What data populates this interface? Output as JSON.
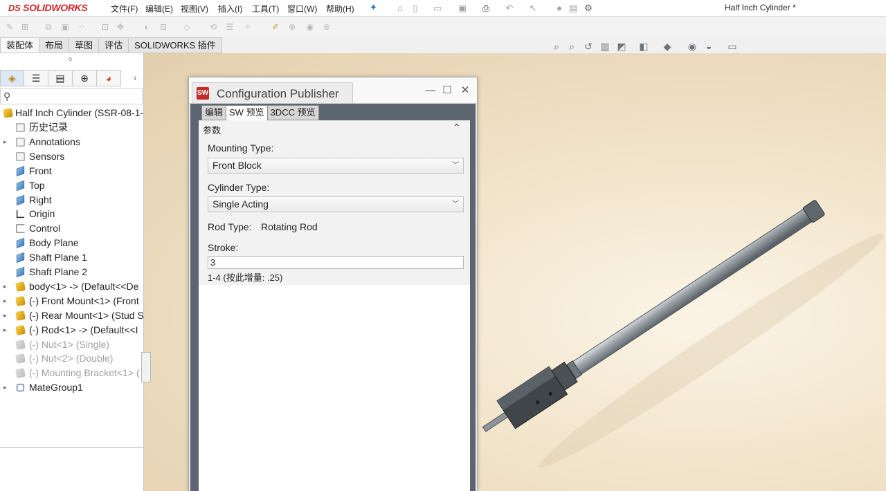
{
  "app": {
    "logo_prefix": "DS",
    "logo": "SOLIDWORKS",
    "document_title": "Half Inch Cylinder *"
  },
  "menu": [
    "文件(F)",
    "编辑(E)",
    "视图(V)",
    "插入(I)",
    "工具(T)",
    "窗口(W)",
    "帮助(H)"
  ],
  "command_tabs": [
    "装配体",
    "布局",
    "草图",
    "评估",
    "SOLIDWORKS 插件"
  ],
  "feature_tree": {
    "root": "Half Inch Cylinder  (SSR-08-1-",
    "items": [
      {
        "label": "历史记录",
        "icon": "history-icon",
        "expand": false,
        "dim": false
      },
      {
        "label": "Annotations",
        "icon": "annotations-icon",
        "expand": true,
        "dim": false
      },
      {
        "label": "Sensors",
        "icon": "sensors-icon",
        "expand": false,
        "dim": false
      },
      {
        "label": "Front",
        "icon": "plane-icon",
        "expand": false,
        "dim": false
      },
      {
        "label": "Top",
        "icon": "plane-icon",
        "expand": false,
        "dim": false
      },
      {
        "label": "Right",
        "icon": "plane-icon",
        "expand": false,
        "dim": false
      },
      {
        "label": "Origin",
        "icon": "origin-icon",
        "expand": false,
        "dim": false
      },
      {
        "label": "Control",
        "icon": "sketch-icon",
        "expand": false,
        "dim": false
      },
      {
        "label": "Body Plane",
        "icon": "plane-icon",
        "expand": false,
        "dim": false
      },
      {
        "label": "Shaft Plane 1",
        "icon": "plane-icon",
        "expand": false,
        "dim": false
      },
      {
        "label": "Shaft Plane 2",
        "icon": "plane-icon",
        "expand": false,
        "dim": false
      },
      {
        "label": "body<1> -> (Default<<De",
        "icon": "component-icon",
        "expand": true,
        "dim": false
      },
      {
        "label": "(-) Front Mount<1> (Front",
        "icon": "component-icon",
        "expand": true,
        "dim": false
      },
      {
        "label": "(-) Rear Mount<1> (Stud S",
        "icon": "component-icon",
        "expand": true,
        "dim": false
      },
      {
        "label": "(-) Rod<1> -> (Default<<I",
        "icon": "component-icon",
        "expand": true,
        "dim": false
      },
      {
        "label": "(-) Nut<1> (Single)",
        "icon": "component-icon",
        "expand": false,
        "dim": true
      },
      {
        "label": "(-) Nut<2> (Double)",
        "icon": "component-icon",
        "expand": false,
        "dim": true
      },
      {
        "label": "(-) Mounting Bracket<1> (",
        "icon": "component-icon",
        "expand": false,
        "dim": true
      },
      {
        "label": "MateGroup1",
        "icon": "mates-icon",
        "expand": true,
        "dim": false
      }
    ]
  },
  "config_publisher": {
    "title": "Configuration Publisher",
    "tabs": [
      "编辑",
      "SW 预览",
      "3DCC 预览"
    ],
    "active_tab": "SW 预览",
    "group_header": "参数",
    "mounting_type_label": "Mounting Type:",
    "mounting_type_value": "Front Block",
    "cylinder_type_label": "Cylinder Type:",
    "cylinder_type_value": "Single Acting",
    "rod_type_label": "Rod Type:",
    "rod_type_value": "Rotating Rod",
    "stroke_label": "Stroke:",
    "stroke_value": "3",
    "stroke_hint": "1-4 (按此增量: .25)"
  },
  "colors": {
    "brand_red": "#d2232a",
    "viewport_bg": "#f1e3c9"
  }
}
